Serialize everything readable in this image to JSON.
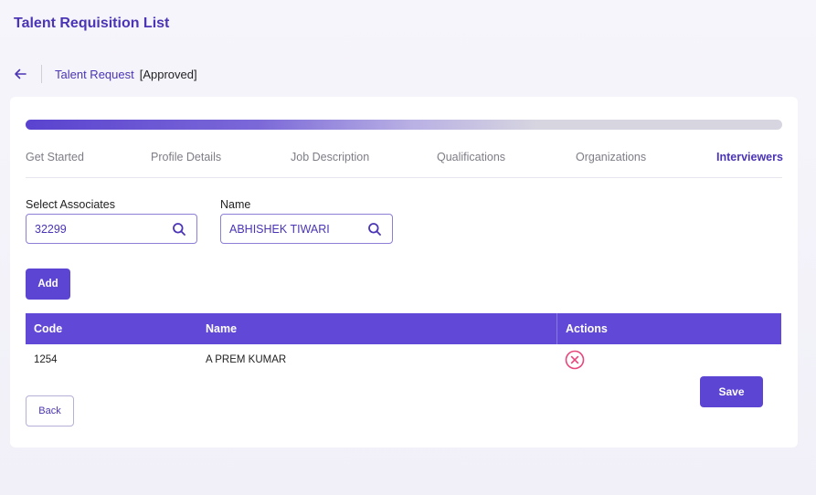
{
  "page": {
    "title": "Talent Requisition List"
  },
  "subheader": {
    "link": "Talent Request",
    "status": "[Approved]"
  },
  "progress": {
    "fraction": 0.68
  },
  "steps": [
    {
      "label": "Get Started",
      "active": false
    },
    {
      "label": "Profile Details",
      "active": false
    },
    {
      "label": "Job Description",
      "active": false
    },
    {
      "label": "Qualifications",
      "active": false
    },
    {
      "label": "Organizations",
      "active": false
    },
    {
      "label": "Interviewers",
      "active": true
    }
  ],
  "form": {
    "associates": {
      "label": "Select Associates",
      "value": "32299"
    },
    "name": {
      "label": "Name",
      "value": "ABHISHEK TIWARI"
    },
    "add_label": "Add"
  },
  "table": {
    "headers": {
      "code": "Code",
      "name": "Name",
      "actions": "Actions"
    },
    "rows": [
      {
        "code": "1254",
        "name": "A PREM KUMAR"
      }
    ]
  },
  "buttons": {
    "save": "Save",
    "back": "Back"
  },
  "colors": {
    "accent": "#5d45d3",
    "header_bg": "#6148d6",
    "remove": "#e8457a"
  },
  "icons": {
    "back": "arrow-left-icon",
    "search": "search-icon",
    "remove": "close-circle-icon"
  }
}
